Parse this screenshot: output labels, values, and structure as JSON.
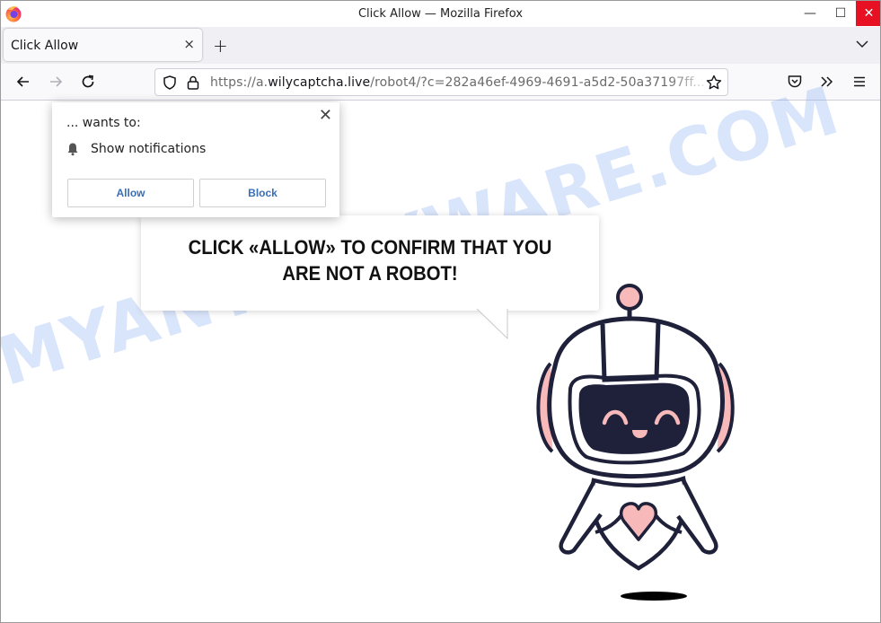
{
  "window": {
    "title": "Click Allow — Mozilla Firefox",
    "controls": {
      "minimize": "—",
      "maximize": "☐",
      "close": "✕"
    },
    "close_color": "#e81123"
  },
  "tabs": [
    {
      "label": "Click Allow",
      "active": true,
      "close_glyph": "×"
    }
  ],
  "tabbar": {
    "new_tab_glyph": "+"
  },
  "navbar": {
    "url_prefix": "https://a.",
    "url_host": "wilycaptcha.live",
    "url_path": "/robot4/?c=282a46ef-4969-4691-a5d2-50a37197ff..."
  },
  "permission_popup": {
    "wants_text": "... wants to:",
    "permission": "Show notifications",
    "allow_label": "Allow",
    "block_label": "Block",
    "close_glyph": "✕",
    "button_text_color": "#3a6eb5"
  },
  "page": {
    "headline": "CLICK «ALLOW» TO CONFIRM THAT YOU ARE NOT A ROBOT!",
    "watermark": "MYANTISPYWARE.COM",
    "robot_colors": {
      "outline": "#1e2139",
      "accent": "#f7b9b9",
      "screen": "#1e2139"
    }
  }
}
